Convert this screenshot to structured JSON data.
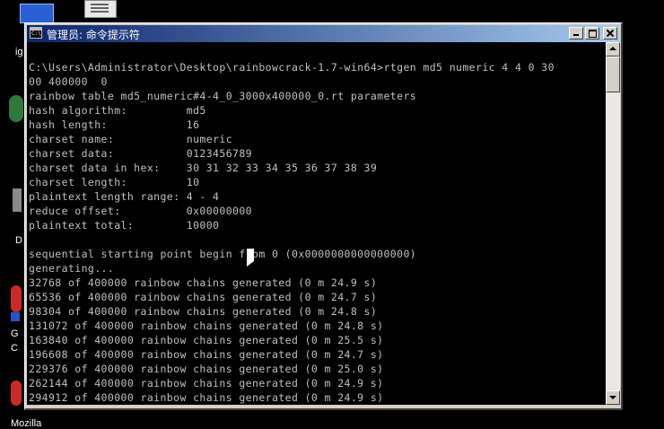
{
  "desktop": {
    "fragments": [
      {
        "id": "frag-1",
        "text": "ig"
      },
      {
        "id": "frag-2",
        "text": "D"
      },
      {
        "id": "frag-3",
        "text": "G"
      },
      {
        "id": "frag-4",
        "text": "C"
      },
      {
        "id": "frag-5",
        "text": "Mozilla"
      }
    ]
  },
  "window": {
    "title": "管理员: 命令提示符",
    "title_icon": "console-icon",
    "controls": {
      "minimize": "minimize-icon",
      "maximize": "maximize-icon",
      "close": "close-icon"
    },
    "scroll": {
      "up_icon": "scroll-up-icon",
      "down_icon": "scroll-down-icon"
    },
    "text_color": "#c0c0c0",
    "background_color": "#000000"
  },
  "console": {
    "lines": [
      "C:\\Users\\Administrator\\Desktop\\rainbowcrack-1.7-win64>rtgen md5 numeric 4 4 0 30",
      "00 400000  0",
      "rainbow table md5_numeric#4-4_0_3000x400000_0.rt parameters",
      "hash algorithm:         md5",
      "hash length:            16",
      "charset name:           numeric",
      "charset data:           0123456789",
      "charset data in hex:    30 31 32 33 34 35 36 37 38 39",
      "charset length:         10",
      "plaintext length range: 4 - 4",
      "reduce offset:          0x00000000",
      "plaintext total:        10000",
      "",
      "sequential starting point begin from 0 (0x0000000000000000)",
      "generating...",
      "32768 of 400000 rainbow chains generated (0 m 24.9 s)",
      "65536 of 400000 rainbow chains generated (0 m 24.7 s)",
      "98304 of 400000 rainbow chains generated (0 m 24.8 s)",
      "131072 of 400000 rainbow chains generated (0 m 24.8 s)",
      "163840 of 400000 rainbow chains generated (0 m 25.5 s)",
      "196608 of 400000 rainbow chains generated (0 m 24.7 s)",
      "229376 of 400000 rainbow chains generated (0 m 25.0 s)",
      "262144 of 400000 rainbow chains generated (0 m 24.9 s)",
      "294912 of 400000 rainbow chains generated (0 m 24.9 s)"
    ]
  }
}
